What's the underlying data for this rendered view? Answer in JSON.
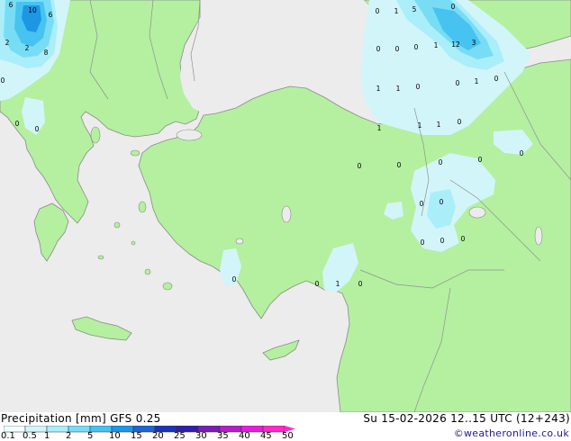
{
  "map": {
    "grid_values": [
      {
        "text": "6"
      },
      {
        "text": "10"
      },
      {
        "text": "6"
      },
      {
        "text": "2"
      },
      {
        "text": "2"
      },
      {
        "text": "8"
      },
      {
        "text": "0"
      },
      {
        "text": "0"
      },
      {
        "text": "0"
      },
      {
        "text": "0"
      },
      {
        "text": "1"
      },
      {
        "text": "5"
      },
      {
        "text": "0"
      },
      {
        "text": "0"
      },
      {
        "text": "0"
      },
      {
        "text": "0"
      },
      {
        "text": "1"
      },
      {
        "text": "12"
      },
      {
        "text": "3"
      },
      {
        "text": "0"
      },
      {
        "text": "1"
      },
      {
        "text": "0"
      },
      {
        "text": "1"
      },
      {
        "text": "1"
      },
      {
        "text": "0"
      },
      {
        "text": "1"
      },
      {
        "text": "1"
      },
      {
        "text": "1"
      },
      {
        "text": "0"
      },
      {
        "text": "0"
      },
      {
        "text": "0"
      },
      {
        "text": "0"
      },
      {
        "text": "0"
      },
      {
        "text": "0"
      },
      {
        "text": "0"
      },
      {
        "text": "0"
      },
      {
        "text": "0"
      },
      {
        "text": "0"
      },
      {
        "text": "0"
      },
      {
        "text": "0"
      },
      {
        "text": "0"
      },
      {
        "text": "1"
      },
      {
        "text": "0"
      }
    ]
  },
  "footer": {
    "title": "Precipitation [mm]  GFS 0.25",
    "valid_time": "Su 15-02-2026 12..15 UTC (12+243)",
    "credit": "©weatheronline.co.uk",
    "legend": {
      "ticks": [
        "0.1",
        "0.5",
        "1",
        "2",
        "5",
        "10",
        "15",
        "20",
        "25",
        "30",
        "35",
        "40",
        "45",
        "50"
      ],
      "colors": [
        "#f0ffff",
        "#d2f5fa",
        "#aaeefa",
        "#78dcf5",
        "#46c3f0",
        "#1e96e6",
        "#1e64d2",
        "#1e32b4",
        "#321eaa",
        "#781eb4",
        "#b41ec8",
        "#e61edc",
        "#ff28c8"
      ]
    }
  }
}
